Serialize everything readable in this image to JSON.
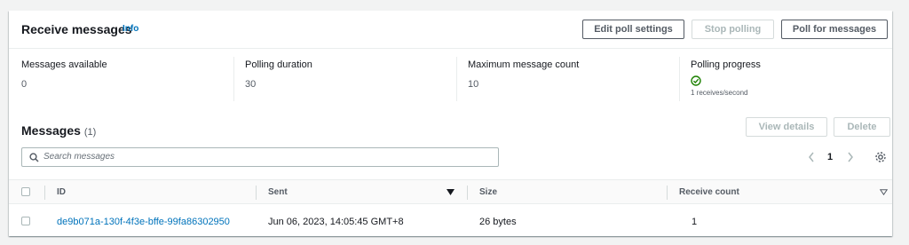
{
  "receive": {
    "title": "Receive messages",
    "info": "Info",
    "buttons": {
      "edit": "Edit poll settings",
      "stop": "Stop polling",
      "poll": "Poll for messages"
    },
    "stats": [
      {
        "label": "Messages available",
        "value": "0"
      },
      {
        "label": "Polling duration",
        "value": "30"
      },
      {
        "label": "Maximum message count",
        "value": "10"
      },
      {
        "label": "Polling progress",
        "value": "1 receives/second"
      }
    ],
    "progress_color": "#1d8102"
  },
  "messages": {
    "title": "Messages",
    "count": "(1)",
    "buttons": {
      "view": "View details",
      "delete": "Delete"
    },
    "search_placeholder": "Search messages",
    "page": "1",
    "columns": [
      "ID",
      "Sent",
      "Size",
      "Receive count"
    ],
    "rows": [
      {
        "id": "de9b071a-130f-4f3e-bffe-99fa86302950",
        "sent": "Jun 06, 2023, 14:05:45 GMT+8",
        "size": "26 bytes",
        "receive_count": "1"
      }
    ]
  },
  "colors": {
    "link": "#0073bb",
    "background": "#f2f3f3"
  }
}
